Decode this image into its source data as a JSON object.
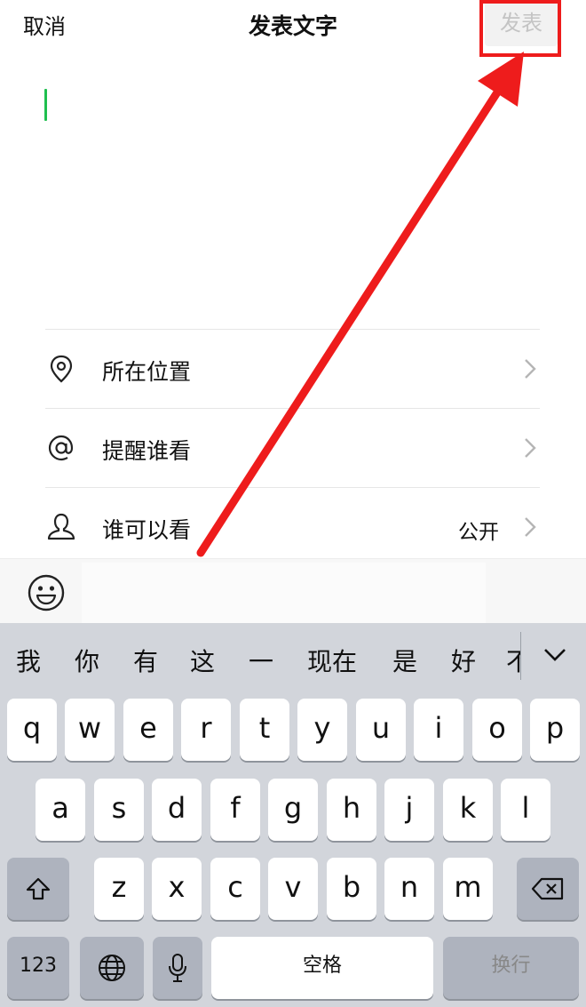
{
  "navbar": {
    "cancel": "取消",
    "title": "发表文字",
    "publish": "发表"
  },
  "options": [
    {
      "icon": "location-pin-icon",
      "label": "所在位置",
      "value": ""
    },
    {
      "icon": "at-sign-icon",
      "label": "提醒谁看",
      "value": ""
    },
    {
      "icon": "person-icon",
      "label": "谁可以看",
      "value": "公开"
    }
  ],
  "keyboard": {
    "candidates": [
      "我",
      "你",
      "有",
      "这",
      "一",
      "现在",
      "是",
      "好",
      "不"
    ],
    "row1": [
      "q",
      "w",
      "e",
      "r",
      "t",
      "y",
      "u",
      "i",
      "o",
      "p"
    ],
    "row2": [
      "a",
      "s",
      "d",
      "f",
      "g",
      "h",
      "j",
      "k",
      "l"
    ],
    "row3": [
      "z",
      "x",
      "c",
      "v",
      "b",
      "n",
      "m"
    ],
    "numbers_key": "123",
    "space_key": "空格",
    "return_key": "换行"
  },
  "colors": {
    "cursor": "#1fbf4f",
    "annotation": "#ee1c1c",
    "publish_disabled": "#c4c4c4"
  }
}
